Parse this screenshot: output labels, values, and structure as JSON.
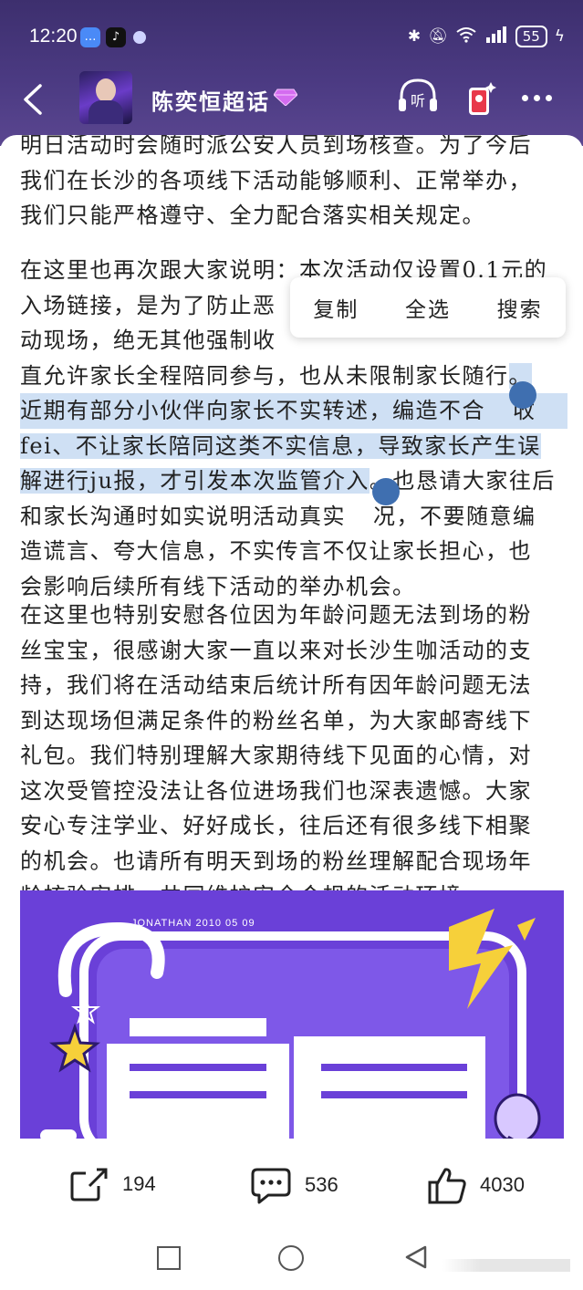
{
  "status_bar": {
    "time": "12:20",
    "battery": "55"
  },
  "header": {
    "title": "陈奕恒超话"
  },
  "context_menu": {
    "copy": "复制",
    "select_all": "全选",
    "search": "搜索"
  },
  "post": {
    "paragraph1": [
      "明日活动时会随时派公安人员到场核查。为了今后",
      "我们在长沙的各项线下活动能够顺利、正常举办，",
      "我们只能严格遵守、全力配合落实相关规定。"
    ],
    "paragraph2": [
      "在这里也再次跟大家说明：本次活动仅设置0.1元的",
      "入场链接，是为了防止恶",
      "动现场，绝无其他强制收",
      "直允许家长全程陪同参与，也从未限制家长随行",
      "近期有部分小伙伴向家长不实转述，编造不合",
      "fei、不让家长陪同这类不实信息，导致家长产生误",
      "解进行ju报，才引发本次监管介入",
      "和家长沟通时如实说明活动真实",
      "造谎言、夸大信息，不实传言不仅让家长担心，也",
      "会影响后续所有线下活动的举办机会。"
    ],
    "paragraph2_tails": {
      "line4_end": "。",
      "line5_end": "收",
      "line7_end": "。也恳请大家往后",
      "line8_end": "况，不要随意编"
    },
    "paragraph3": [
      "在这里也特别安慰各位因为年龄问题无法到场的粉",
      "丝宝宝，很感谢大家一直以来对长沙生咖活动的支",
      "持，我们将在活动结束后统计所有因年龄问题无法",
      "到达现场但满足条件的粉丝名单，为大家邮寄线下",
      "礼包。我们特别理解大家期待线下见面的心情，对",
      "这次受管控没法让各位进场我们也深表遗憾。大家",
      "安心专注学业、好好成长，往后还有很多线下相聚",
      "的机会。也请所有明天到场的粉丝理解配合现场年",
      "龄核验安排，共同维护安全合规的活动环境。"
    ]
  },
  "banner": {
    "caption": "JONATHAN  2010    05  09",
    "accent": "#6a40d8"
  },
  "actions": {
    "share_count": "194",
    "comment_count": "536",
    "like_count": "4030"
  },
  "colors": {
    "header_bg": "#4b3a82",
    "selection": "#cfe0f4",
    "handle": "#3f6fb0"
  }
}
